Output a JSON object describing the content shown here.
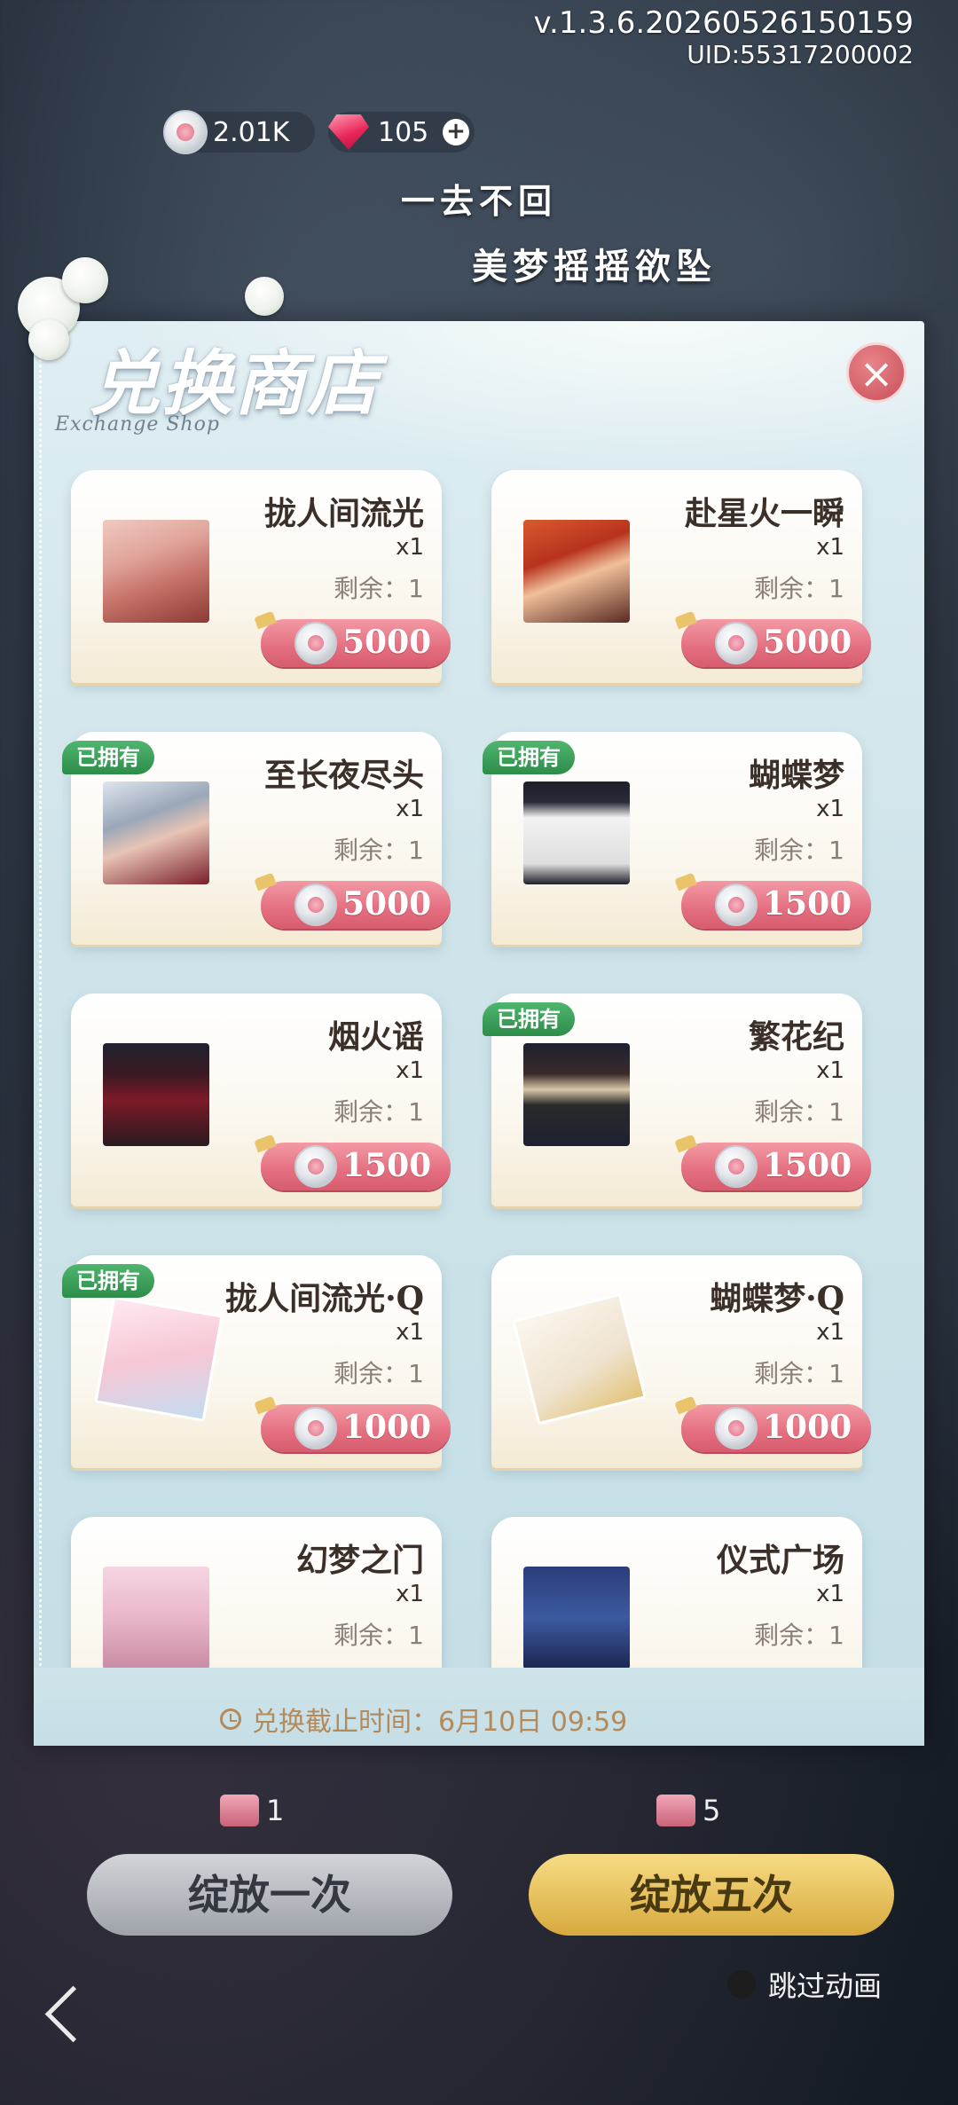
{
  "meta": {
    "version": "v.1.3.6.20260526150159",
    "uid": "UID:55317200002"
  },
  "currency": {
    "coin_amount": "2.01K",
    "gem_amount": "105",
    "coin_icon": "silver-rose-coin-icon",
    "gem_icon": "pink-gem-icon"
  },
  "banner": {
    "line1": "一去不回",
    "line2": "美梦摇摇欲坠"
  },
  "shop": {
    "title": "兑换商店",
    "subtitle": "Exchange Shop",
    "close_label": "×",
    "owned_label": "已拥有",
    "remain_prefix": "剩余：",
    "items": [
      {
        "name": "拢人间流光",
        "qty": "x1",
        "remain": "剩余：1",
        "price": "5000",
        "owned": false,
        "owned_label": "",
        "art": "art-red-hair"
      },
      {
        "name": "赴星火一瞬",
        "qty": "x1",
        "remain": "剩余：1",
        "price": "5000",
        "owned": false,
        "owned_label": "",
        "art": "art-orange-hair"
      },
      {
        "name": "至长夜尽头",
        "qty": "x1",
        "remain": "剩余：1",
        "price": "5000",
        "owned": true,
        "owned_label": "已拥有",
        "art": "art-silver-hair"
      },
      {
        "name": "蝴蝶梦",
        "qty": "x1",
        "remain": "剩余：1",
        "price": "1500",
        "owned": true,
        "owned_label": "已拥有",
        "art": "art-white-suit"
      },
      {
        "name": "烟火谣",
        "qty": "x1",
        "remain": "剩余：1",
        "price": "1500",
        "owned": false,
        "owned_label": "",
        "art": "art-red-coat"
      },
      {
        "name": "繁花纪",
        "qty": "x1",
        "remain": "剩余：1",
        "price": "1500",
        "owned": true,
        "owned_label": "已拥有",
        "art": "art-black-coat"
      },
      {
        "name": "拢人间流光·Q",
        "qty": "x1",
        "remain": "剩余：1",
        "price": "1000",
        "owned": true,
        "owned_label": "已拥有",
        "art": "art-chibi-card"
      },
      {
        "name": "蝴蝶梦·Q",
        "qty": "x1",
        "remain": "剩余：1",
        "price": "1000",
        "owned": false,
        "owned_label": "",
        "art": "art-fashion-card"
      },
      {
        "name": "幻梦之门",
        "qty": "x1",
        "remain": "剩余：1",
        "price": "",
        "owned": false,
        "owned_label": "",
        "art": "art-pink-room"
      },
      {
        "name": "仪式广场",
        "qty": "x1",
        "remain": "剩余：1",
        "price": "",
        "owned": false,
        "owned_label": "",
        "art": "art-night-plaza"
      }
    ],
    "deadline": "兑换截止时间：6月10日 09:59"
  },
  "background_ui": {
    "draw_once": "绽放一次",
    "draw_five": "绽放五次",
    "ticket_once_count": "1",
    "ticket_five_count": "5",
    "skip_animation": "跳过动画"
  },
  "colors": {
    "accent_pink": "#e46e7f",
    "owned_green": "#3a9e5a",
    "deadline_gold": "#b48a5a",
    "modal_bg": "#d5e7ec"
  }
}
